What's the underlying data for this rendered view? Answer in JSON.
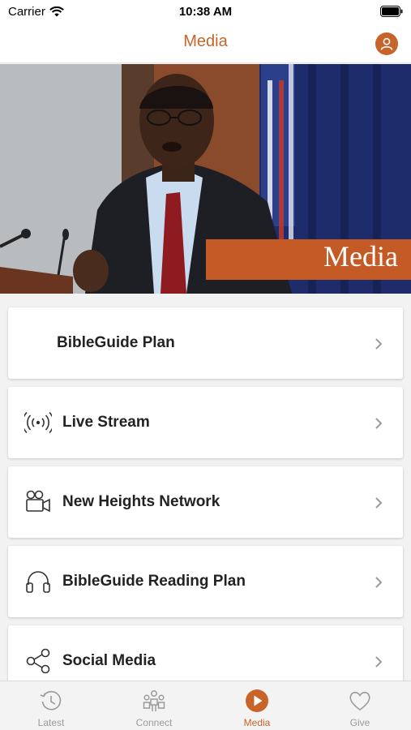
{
  "status_bar": {
    "carrier": "Carrier",
    "time": "10:38 AM"
  },
  "nav": {
    "title": "Media",
    "accent_color": "#c8642a"
  },
  "hero": {
    "label": "Media"
  },
  "menu": {
    "items": [
      {
        "label": "BibleGuide Plan",
        "icon": "none"
      },
      {
        "label": "Live Stream",
        "icon": "broadcast-icon"
      },
      {
        "label": "New Heights Network",
        "icon": "video-camera-icon"
      },
      {
        "label": "BibleGuide Reading Plan",
        "icon": "headphones-icon"
      },
      {
        "label": "Social Media",
        "icon": "share-icon"
      }
    ]
  },
  "tabs": [
    {
      "label": "Latest",
      "icon": "history-icon",
      "active": false
    },
    {
      "label": "Connect",
      "icon": "people-icon",
      "active": false
    },
    {
      "label": "Media",
      "icon": "play-icon",
      "active": true
    },
    {
      "label": "Give",
      "icon": "heart-icon",
      "active": false
    }
  ]
}
